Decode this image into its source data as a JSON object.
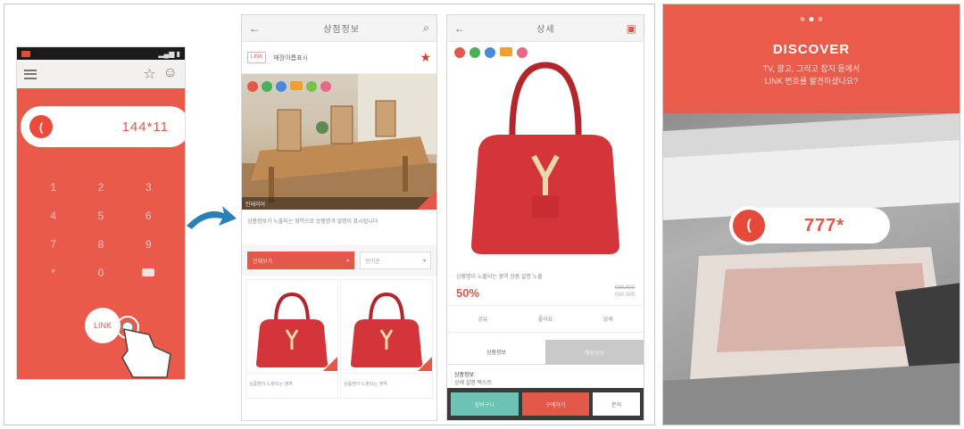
{
  "colors": {
    "brand_red": "#ea5a4b",
    "teal": "#6bc3b4",
    "dark": "#3a3a3a"
  },
  "phone1": {
    "code": "144*11",
    "keys": [
      "1",
      "2",
      "3",
      "4",
      "5",
      "6",
      "7",
      "8",
      "9",
      "*",
      "0",
      "del"
    ],
    "link_label": "LINK"
  },
  "phone2": {
    "title": "상점정보",
    "store_logo": "LINK",
    "store_name": "매장이름표시",
    "photo_caption": "인테리어",
    "description": "상품정보가 노출되는 영역으로 상품명과 설명이 표시됩니다",
    "filter_primary": "전체보기",
    "filter_secondary": "인기순",
    "products": [
      {
        "caption": "상품명이 노출되는 영역"
      },
      {
        "caption": "상품명이 노출되는 영역"
      }
    ]
  },
  "phone3": {
    "title": "상세",
    "description": "상품명이 노출되는 영역 상품 설명 노출",
    "discount": "50%",
    "price_original": "000,000",
    "price_sale": "000,000",
    "actions": [
      "공유",
      "좋아요",
      "상세"
    ],
    "tabs": [
      "상품정보",
      "매장정보"
    ],
    "info_title": "상품정보",
    "info_text": "상세 설명 텍스트",
    "btn_teal": "장바구니",
    "btn_red": "구매하기",
    "btn_white": "문의"
  },
  "discover": {
    "title": "DISCOVER",
    "subtitle_1": "TV, 광고, 그리고 잡지 등에서",
    "subtitle_2": "LINK 번호를 발견하셨나요?",
    "code": "777*"
  }
}
